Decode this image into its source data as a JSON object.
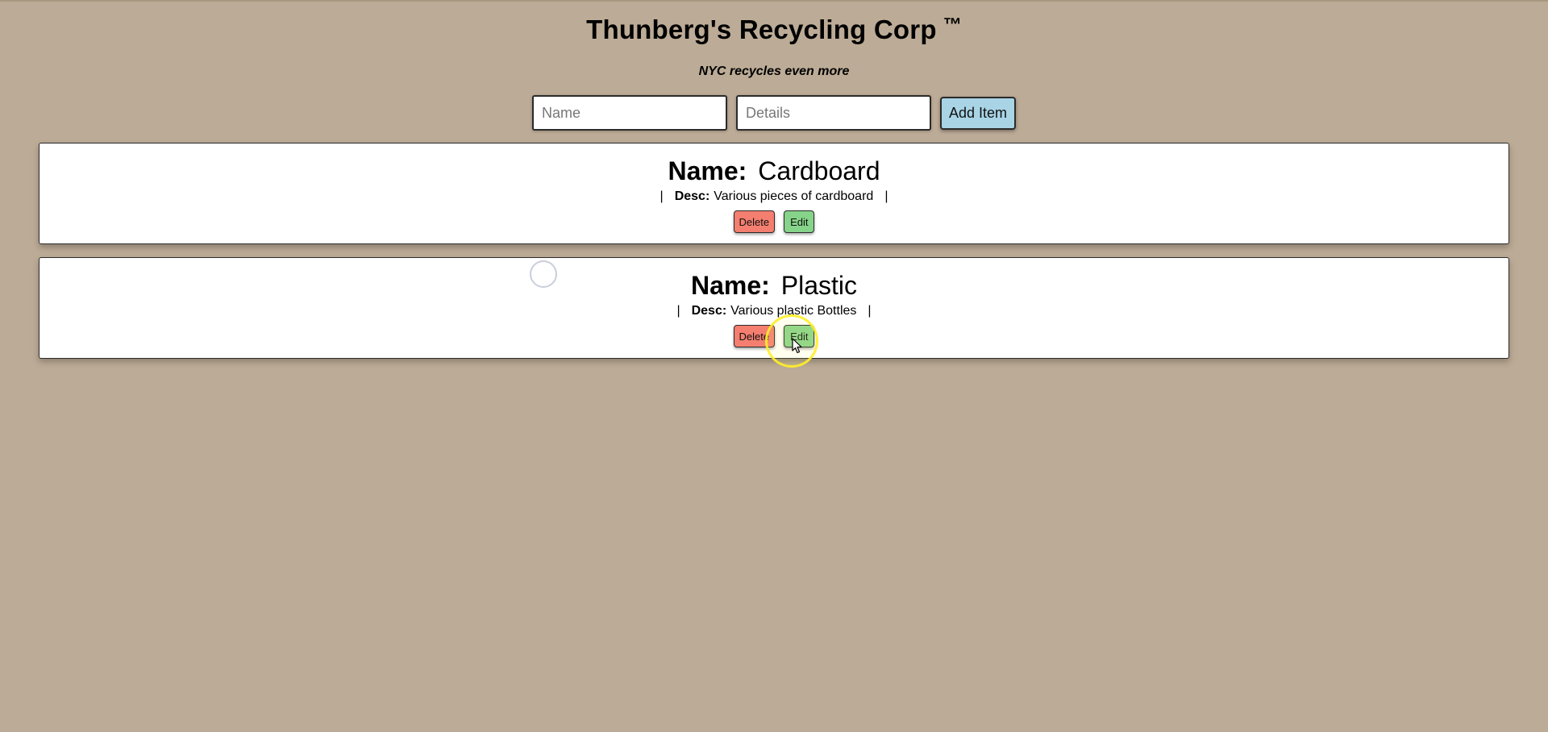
{
  "header": {
    "title": "Thunberg's Recycling Corp",
    "trademark": "™",
    "tagline": "NYC recycles even more"
  },
  "form": {
    "name_placeholder": "Name",
    "details_placeholder": "Details",
    "add_label": "Add Item"
  },
  "items": [
    {
      "name_label": "Name:",
      "name": "Cardboard",
      "desc_label": "Desc:",
      "desc": "Various pieces of cardboard",
      "delete_label": "Delete",
      "edit_label": "Edit"
    },
    {
      "name_label": "Name:",
      "name": "Plastic",
      "desc_label": "Desc:",
      "desc": "Various plastic Bottles",
      "delete_label": "Delete",
      "edit_label": "Edit"
    }
  ],
  "separator": "|",
  "colors": {
    "background": "#bcab96",
    "add_button": "#a8d4e6",
    "delete_button": "#f47e6f",
    "edit_button": "#86d489",
    "click_highlight": "#ffee28"
  }
}
